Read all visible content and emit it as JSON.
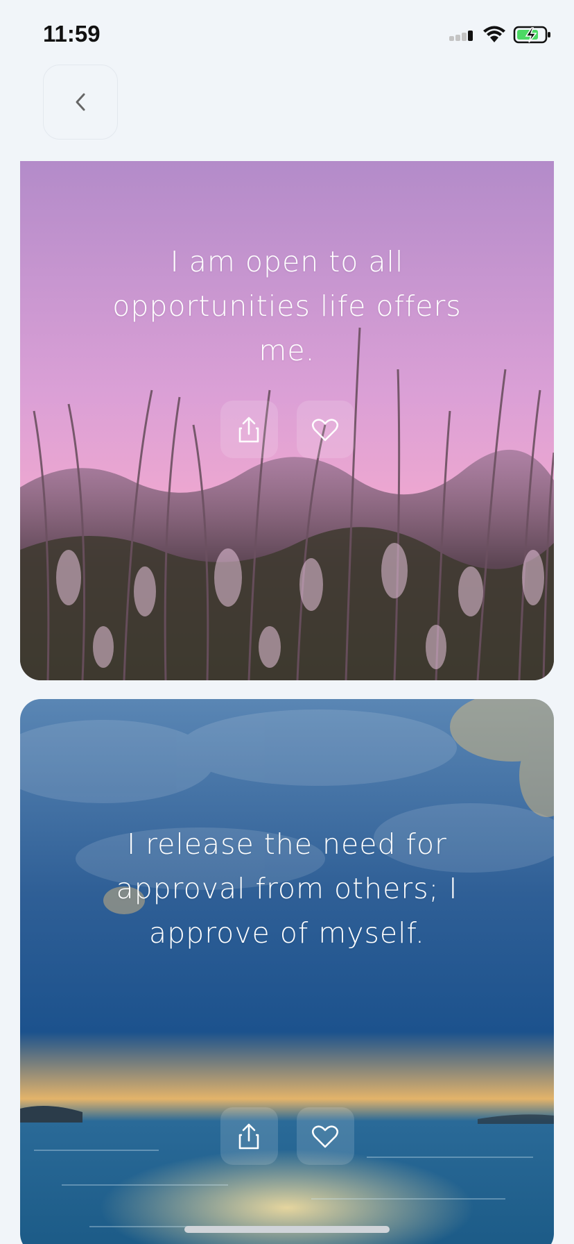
{
  "status_bar": {
    "time": "11:59"
  },
  "cards": [
    {
      "quote": "I am open to all opportunities life offers me."
    },
    {
      "quote": "I release the need for approval from others; I approve of myself."
    }
  ],
  "icons": {
    "back": "chevron-left-icon",
    "share": "share-icon",
    "favorite": "heart-icon"
  },
  "colors": {
    "background": "#f1f5f9",
    "card1_sky_top": "#b48bc9",
    "card1_sky_bottom": "#f0a8cf",
    "card2_sky": "#2c5a91",
    "card2_sea": "#1e5f8f"
  }
}
